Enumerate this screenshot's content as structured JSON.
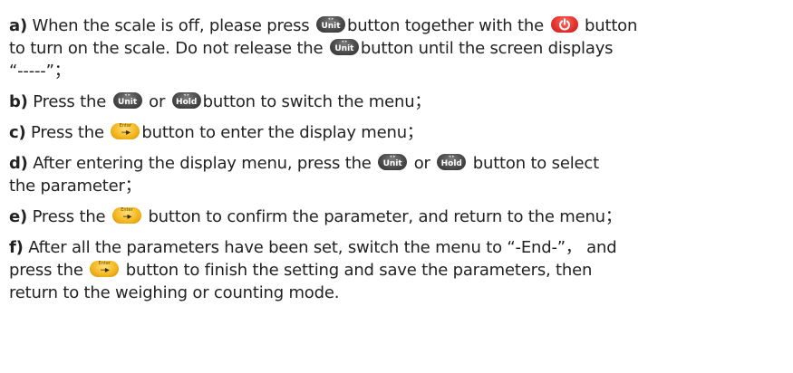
{
  "button_icons": {
    "unit": {
      "label": "Unit",
      "icon": "unit-button-icon",
      "color": "#4b4b4b"
    },
    "hold": {
      "label": "Hold",
      "icon": "hold-button-icon",
      "color": "#4b4b4b"
    },
    "power": {
      "icon": "power-button-icon",
      "color": "#e4312b"
    },
    "enter": {
      "label": "Enter",
      "icon": "enter-button-icon",
      "color": "#f2b51c"
    }
  },
  "steps": {
    "a": {
      "marker": "a)",
      "t1": " When the scale is off, please press ",
      "t2": "button together with the ",
      "t3": " button",
      "t4": "to turn on the scale. Do not release the ",
      "t5": "button until the screen displays",
      "t6": "“-----”；"
    },
    "b": {
      "marker": "b)",
      "t1": " Press the ",
      "t2": " or ",
      "t3": "button to switch the menu；"
    },
    "c": {
      "marker": "c)",
      "t1": " Press the ",
      "t2": "button to enter the display menu；"
    },
    "d": {
      "marker": "d)",
      "t1": " After entering the display menu, press the ",
      "t2": " or ",
      "t3": " button to select",
      "t4": "the parameter；"
    },
    "e": {
      "marker": "e)",
      "t1": " Press the ",
      "t2": "  button to confirm the parameter, and return to the menu；"
    },
    "f": {
      "marker": "f)",
      "t1": " After all the parameters have been set, switch the menu to “-End-”， and",
      "t2": "press the ",
      "t3": "  button to finish the setting and save the parameters, then",
      "t4": "return to the weighing or counting mode."
    }
  }
}
